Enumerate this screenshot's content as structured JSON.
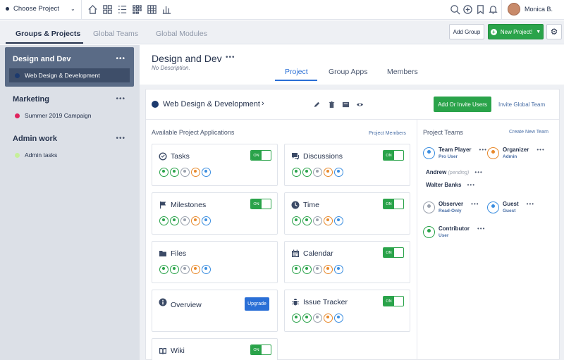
{
  "topbar": {
    "project_selector": "Choose Project",
    "user_name": "Monica B."
  },
  "subtabs": [
    "Groups & Projects",
    "Global Teams",
    "Global Modules"
  ],
  "actions": {
    "add_group": "Add Group",
    "new_project": "New Project!"
  },
  "sidebar": {
    "groups": [
      {
        "title": "Design and Dev",
        "items": [
          {
            "label": "Web Design & Development",
            "color": "#1c3a6e"
          }
        ]
      },
      {
        "title": "Marketing",
        "items": [
          {
            "label": "Summer 2019 Campaign",
            "color": "#e0245e"
          }
        ]
      },
      {
        "title": "Admin work",
        "items": [
          {
            "label": "Admin tasks",
            "color": "#c6ef9a"
          }
        ]
      }
    ],
    "more": "•••"
  },
  "project": {
    "title": "Design and Dev",
    "description": "No Description.",
    "tabs": [
      "Project",
      "Group Apps",
      "Members"
    ]
  },
  "card": {
    "title": "Web Design & Development",
    "invite_button": "Add Or Invite Users",
    "global_team_link": "Invite Global Team",
    "available_heading": "Available Project Applications",
    "project_members_link": "Project Members",
    "toggle_on": "ON",
    "upgrade": "Upgrade",
    "apps": [
      {
        "name": "Tasks",
        "icon": "check-circle-icon"
      },
      {
        "name": "Discussions",
        "icon": "chat-icon"
      },
      {
        "name": "Milestones",
        "icon": "flag-icon"
      },
      {
        "name": "Time",
        "icon": "clock-icon"
      },
      {
        "name": "Files",
        "icon": "folder-icon"
      },
      {
        "name": "Calendar",
        "icon": "calendar-icon"
      },
      {
        "name": "Overview",
        "icon": "info-icon"
      },
      {
        "name": "Issue Tracker",
        "icon": "bug-icon"
      },
      {
        "name": "Wiki",
        "icon": "book-icon"
      }
    ]
  },
  "teams": {
    "heading": "Project Teams",
    "create_link": "Create New Team",
    "members": [
      {
        "name": "Team Player",
        "role": "Pro User"
      },
      {
        "name": "Organizer",
        "role": "Admin"
      },
      {
        "name": "Observer",
        "role": "Read-Only"
      },
      {
        "name": "Guest",
        "role": "Guest"
      },
      {
        "name": "Contributor",
        "role": "User"
      }
    ],
    "pending": [
      {
        "name": "Andrew",
        "note": "(pending)"
      },
      {
        "name": "Walter Banks",
        "note": ""
      }
    ]
  },
  "colors": {
    "accent_green": "#2aa34a",
    "accent_blue": "#2a6fd6",
    "navy": "#26334d"
  }
}
